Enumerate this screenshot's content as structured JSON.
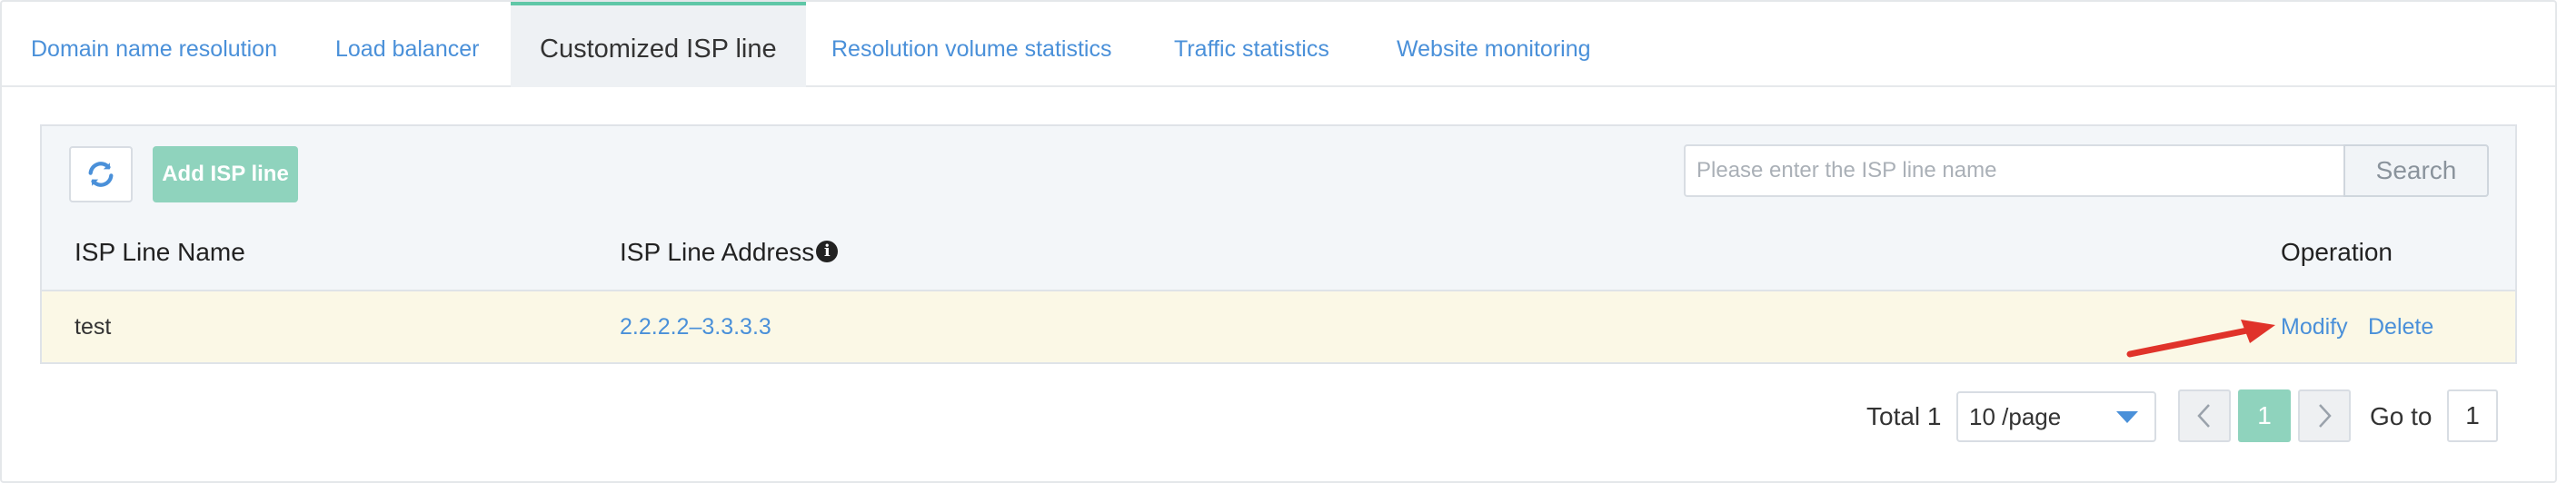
{
  "tabs": [
    {
      "label": "Domain name resolution",
      "active": false
    },
    {
      "label": "Load balancer",
      "active": false
    },
    {
      "label": "Customized ISP line",
      "active": true
    },
    {
      "label": "Resolution volume statistics",
      "active": false
    },
    {
      "label": "Traffic statistics",
      "active": false
    },
    {
      "label": "Website monitoring",
      "active": false
    }
  ],
  "toolbar": {
    "refresh_icon": "refresh-icon",
    "add_label": "Add ISP line",
    "search_placeholder": "Please enter the ISP line name",
    "search_value": "",
    "search_label": "Search"
  },
  "table": {
    "columns": [
      "ISP Line Name",
      "ISP Line Address",
      "Operation"
    ],
    "rows": [
      {
        "name": "test",
        "address": "2.2.2.2–3.3.3.3",
        "actions": [
          "Modify",
          "Delete"
        ]
      }
    ]
  },
  "annotation": {
    "arrow_color": "#e0332a",
    "points_to": "Modify"
  },
  "pagination": {
    "total_text": "Total 1",
    "page_size": "10 /page",
    "current_page": "1",
    "goto_label": "Go to",
    "goto_value": "1"
  },
  "colors": {
    "accent": "#8fd3bd",
    "link": "#4a90d9",
    "active_tab_border": "#5fc7a7",
    "row_highlight": "#fbf8e6"
  }
}
